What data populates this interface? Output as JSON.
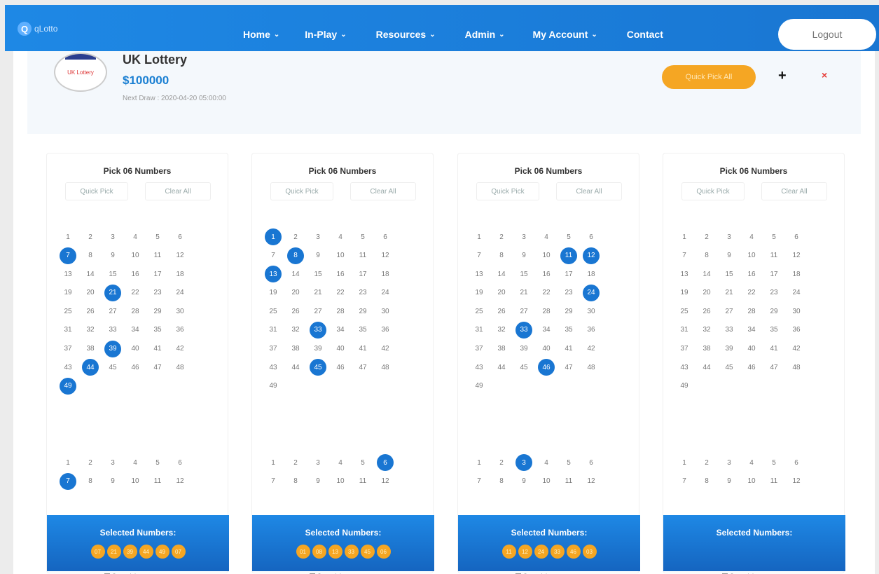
{
  "nav": {
    "logo_text": "qLotto",
    "logo_mark": "Q",
    "menu": [
      {
        "key": "home",
        "label": "Home"
      },
      {
        "key": "in-play",
        "label": "In-Play"
      },
      {
        "key": "resources",
        "label": "Resources"
      },
      {
        "key": "admin",
        "label": "Admin"
      },
      {
        "key": "my-account",
        "label": "My Account"
      },
      {
        "key": "contact",
        "label": "Contact"
      }
    ],
    "logout": "Logout"
  },
  "lottery": {
    "logo_text": "UK Lottery",
    "name": "UK Lottery",
    "prize": "$100000",
    "next_draw": "Next Draw : 2020-04-20 05:00:00",
    "quick_pick_all": "Quick Pick All",
    "add_symbol": "+",
    "remove_symbol": "×"
  },
  "tickets": [
    {
      "title": "Pick 06 Numbers",
      "quick_pick": "Quick Pick",
      "clear_all": "Clear All",
      "main_selected": [
        7,
        21,
        39,
        44,
        49
      ],
      "bonus_selected": [
        7
      ],
      "selected_title": "Selected Numbers:",
      "selected_balls": [
        "07",
        "21",
        "39",
        "44",
        "49",
        "07"
      ],
      "save_label": "Save ticket"
    },
    {
      "title": "Pick 06 Numbers",
      "quick_pick": "Quick Pick",
      "clear_all": "Clear All",
      "main_selected": [
        1,
        8,
        13,
        33,
        45
      ],
      "bonus_selected": [
        6
      ],
      "selected_title": "Selected Numbers:",
      "selected_balls": [
        "01",
        "08",
        "13",
        "33",
        "45",
        "06"
      ],
      "save_label": "Save ticket"
    },
    {
      "title": "Pick 06 Numbers",
      "quick_pick": "Quick Pick",
      "clear_all": "Clear All",
      "main_selected": [
        11,
        12,
        24,
        33,
        46
      ],
      "bonus_selected": [
        3
      ],
      "selected_title": "Selected Numbers:",
      "selected_balls": [
        "11",
        "12",
        "24",
        "33",
        "46",
        "03"
      ],
      "save_label": "Save ticket"
    },
    {
      "title": "Pick 06 Numbers",
      "quick_pick": "Quick Pick",
      "clear_all": "Clear All",
      "main_selected": [],
      "bonus_selected": [],
      "selected_title": "Selected Numbers:",
      "selected_balls": [],
      "save_label": "Save ticket"
    }
  ],
  "main_range": 49,
  "bonus_range": 12,
  "colors": {
    "brand": "#1976d2",
    "accent": "#f5a623",
    "danger": "#e53935"
  },
  "icons": {
    "menu_chevron": "chevron-down-icon",
    "add": "plus-icon",
    "remove": "close-icon"
  }
}
